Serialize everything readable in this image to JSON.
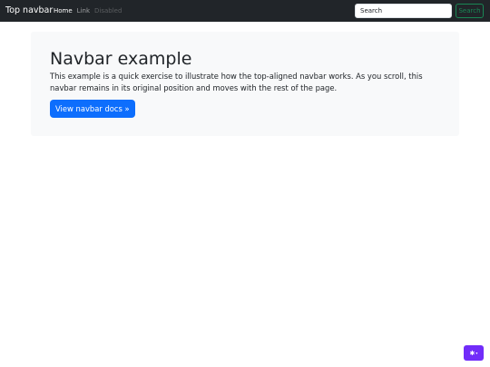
{
  "navbar": {
    "brand": "Top navbar",
    "items": [
      {
        "label": "Home"
      },
      {
        "label": "Link"
      },
      {
        "label": "Disabled"
      }
    ],
    "search_placeholder": "Search",
    "search_button": "Search"
  },
  "jumbotron": {
    "title": "Navbar example",
    "text": "This example is a quick exercise to illustrate how the top-aligned navbar works. As you scroll, this navbar remains in its original position and moves with the rest of the page.",
    "button": "View navbar docs »"
  },
  "theme_toggle": {
    "icon": "theme-icon",
    "glyph": "✱",
    "caret": "▾",
    "color": "#712cf9"
  },
  "colors": {
    "navbar_bg": "#212529",
    "primary": "#0d6efd",
    "success": "#198754",
    "jumbotron_bg": "#f8f9fa"
  }
}
